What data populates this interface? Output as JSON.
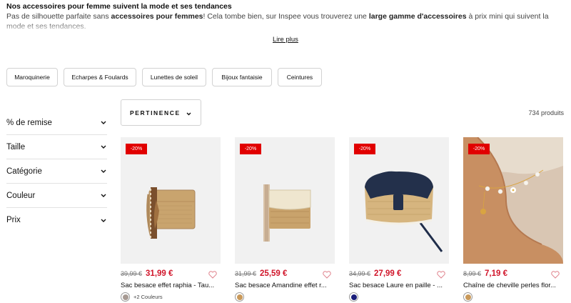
{
  "intro": {
    "title": "Nos accessoires pour femme suivent la mode et ses tendances",
    "text_1": "Pas de silhouette parfaite sans ",
    "text_2": "accessoires pour femmes",
    "text_3": "! Cela tombe bien, sur Inspee vous trouverez une ",
    "text_4": "large gamme d'accessoires",
    "text_5": " à prix mini qui suivent la mode et ses tendances.",
    "read_more": "Lire plus"
  },
  "categories": [
    {
      "label": "Maroquinerie"
    },
    {
      "label": "Echarpes & Foulards"
    },
    {
      "label": "Lunettes de soleil"
    },
    {
      "label": "Bijoux fantaisie"
    },
    {
      "label": "Ceintures"
    }
  ],
  "filters": [
    {
      "label": "% de remise"
    },
    {
      "label": "Taille"
    },
    {
      "label": "Catégorie"
    },
    {
      "label": "Couleur"
    },
    {
      "label": "Prix"
    }
  ],
  "sort": {
    "label": "PERTINENCE"
  },
  "product_count": "734 produits",
  "products": [
    {
      "badge": "-20%",
      "old_price": "39,99 €",
      "price": "31,99 €",
      "name": "Sac besace effet raphia - Tau...",
      "swatch": "#a79a93",
      "more_colors": "+2 Couleurs"
    },
    {
      "badge": "-20%",
      "old_price": "31,99 €",
      "price": "25,59 €",
      "name": "Sac besace Amandine effet r...",
      "swatch": "#c9995a"
    },
    {
      "badge": "-20%",
      "old_price": "34,99 €",
      "price": "27,99 €",
      "name": "Sac besace Laure en paille - ...",
      "swatch": "#1a1d7a"
    },
    {
      "badge": "-20%",
      "old_price": "8,99 €",
      "price": "7,19 €",
      "name": "Chaîne de cheville perles flor...",
      "swatch": "#c9995a"
    }
  ],
  "colors": {
    "sale": "#e10000",
    "price": "#d1162b"
  },
  "icons": {
    "filter_chevron": "chevron-down-icon",
    "favorite": "heart-icon"
  }
}
